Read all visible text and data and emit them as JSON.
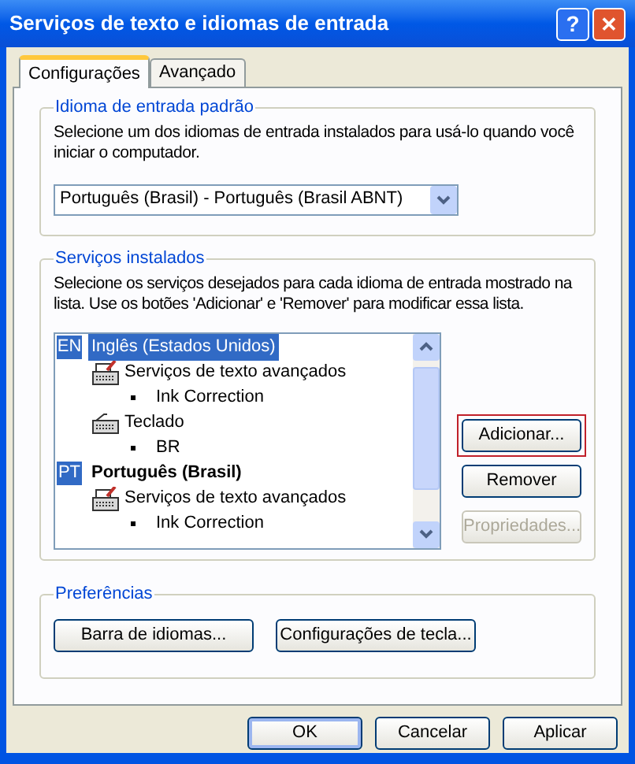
{
  "window": {
    "title": "Serviços de texto e idiomas de entrada",
    "help_button": "?",
    "close_button": "✕"
  },
  "tabs": [
    {
      "label": "Configurações",
      "selected": true
    },
    {
      "label": "Avançado",
      "selected": false
    }
  ],
  "default_language": {
    "legend": "Idioma de entrada padrão",
    "description": "Selecione um dos idiomas de entrada instalados para usá-lo quando você iniciar o computador.",
    "dropdown": {
      "value": "Português (Brasil) - Português (Brasil ABNT)"
    }
  },
  "installed_services": {
    "legend": "Serviços instalados",
    "description": "Selecione os serviços desejados para cada idioma de entrada mostrado na lista. Use os botões 'Adicionar' e 'Remover' para modificar essa lista.",
    "languages": [
      {
        "code": "EN",
        "label": "Inglês (Estados Unidos)",
        "selected": true,
        "default": false,
        "children": [
          {
            "kind": "text-services",
            "label": "Serviços de texto avançados",
            "children": [
              {
                "label": "Ink Correction"
              }
            ]
          },
          {
            "kind": "keyboard",
            "label": "Teclado",
            "children": [
              {
                "label": "BR"
              }
            ]
          }
        ]
      },
      {
        "code": "PT",
        "label": "Português (Brasil)",
        "selected": false,
        "default": true,
        "children": [
          {
            "kind": "text-services",
            "label": "Serviços de texto avançados",
            "children": [
              {
                "label": "Ink Correction"
              }
            ]
          }
        ]
      }
    ],
    "buttons": [
      {
        "label": "Adicionar...",
        "disabled": false,
        "highlighted": true
      },
      {
        "label": "Remover",
        "disabled": false,
        "highlighted": false
      },
      {
        "label": "Propriedades...",
        "disabled": true,
        "highlighted": false
      }
    ]
  },
  "preferences": {
    "legend": "Preferências",
    "buttons": [
      {
        "label": "Barra de idiomas..."
      },
      {
        "label": "Configurações de tecla..."
      }
    ]
  },
  "dialog_buttons": [
    {
      "label": "OK",
      "default": true
    },
    {
      "label": "Cancelar",
      "default": false
    },
    {
      "label": "Aplicar",
      "default": false
    }
  ]
}
